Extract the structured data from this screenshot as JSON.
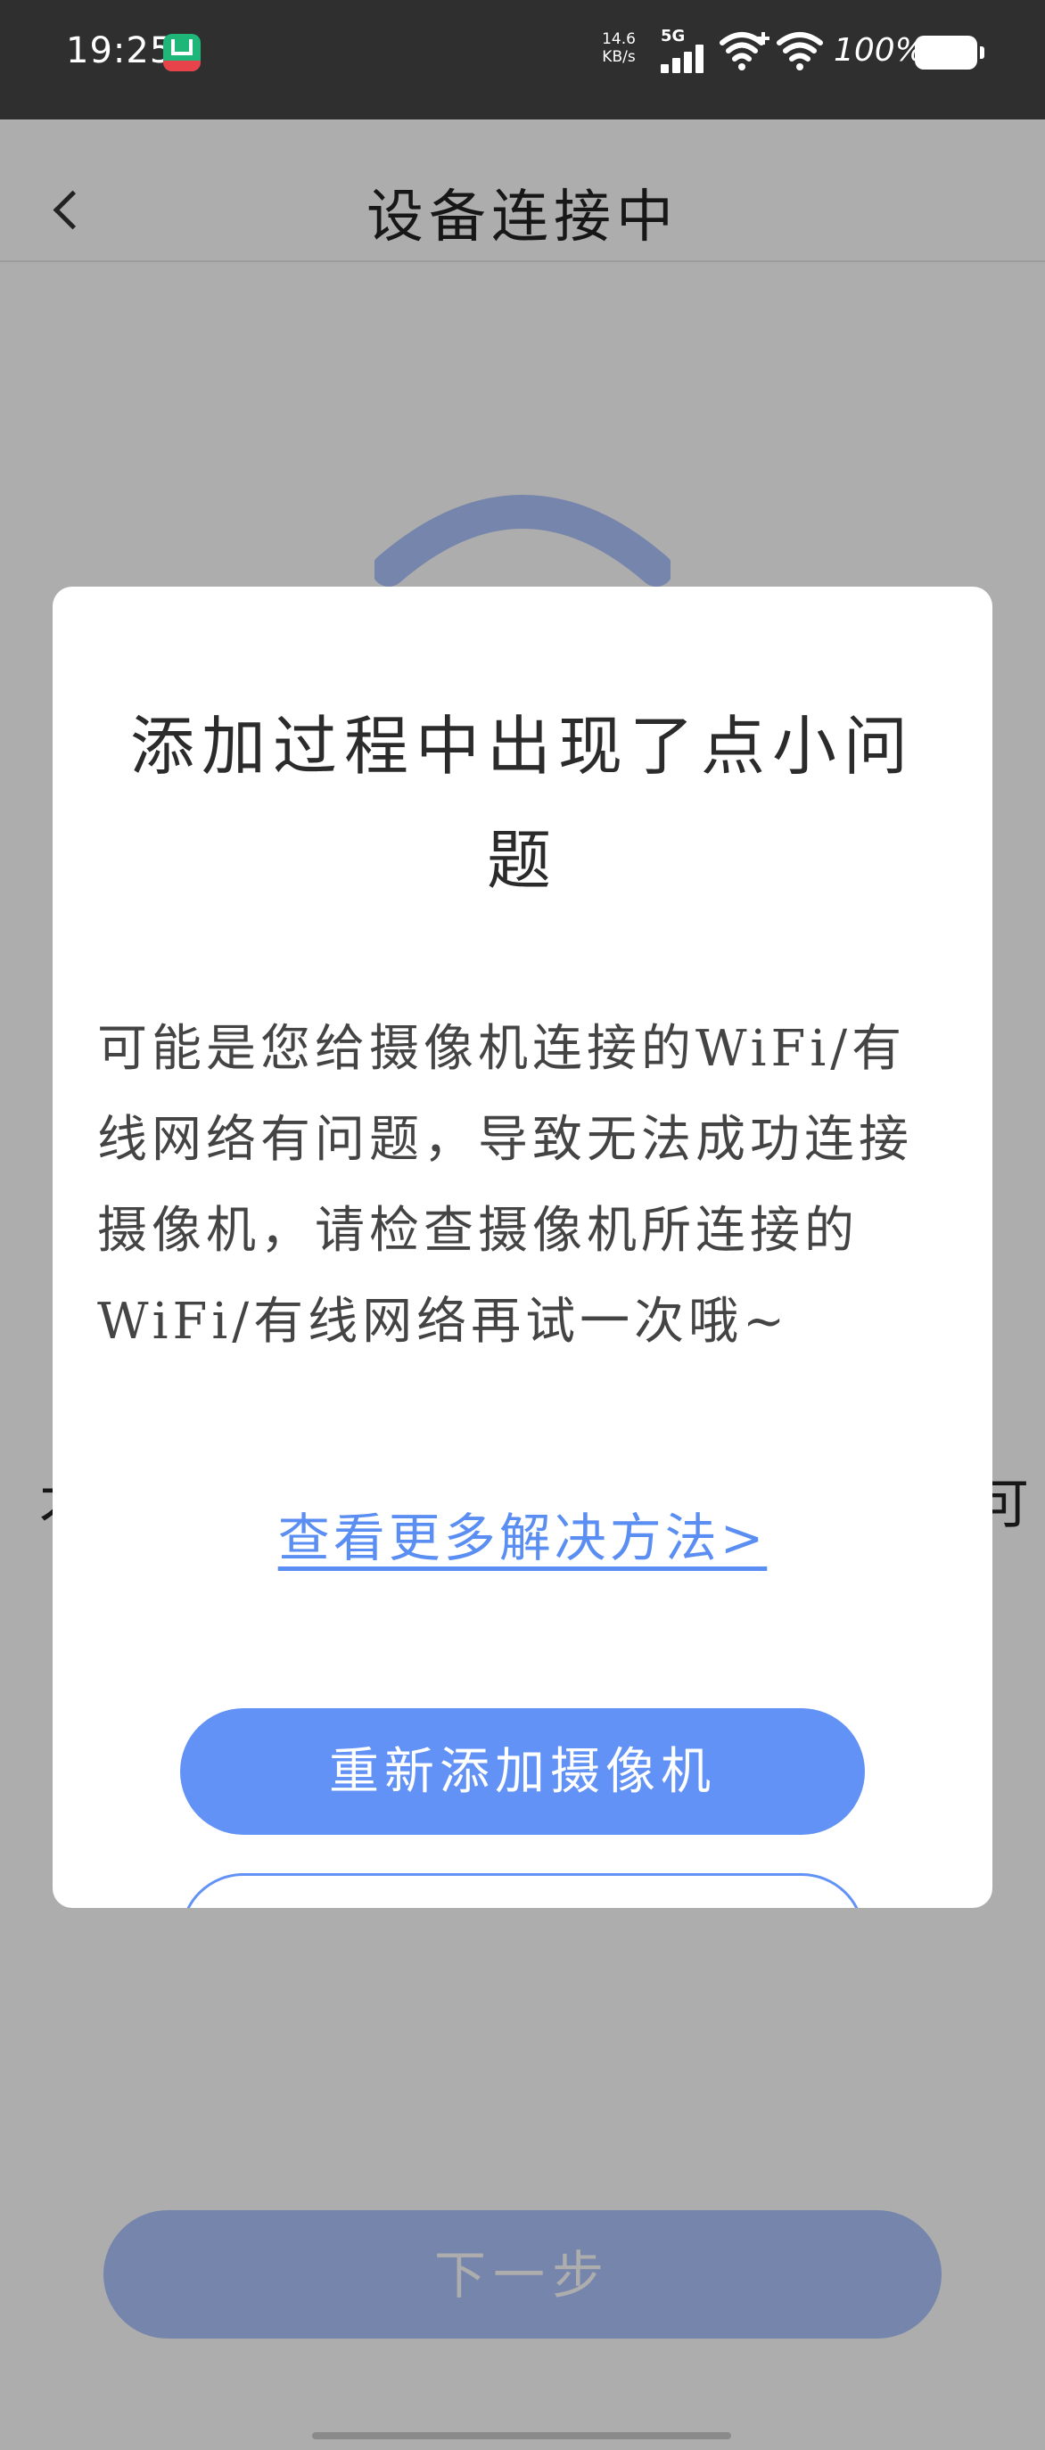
{
  "status_bar": {
    "time": "19:25",
    "net_speed_value": "14.6",
    "net_speed_unit": "KB/s",
    "signal_label": "5G",
    "battery": "100%",
    "icons": [
      "app-notification-icon",
      "cellular-signal-icon",
      "wifi-plus-icon",
      "wifi-icon",
      "battery-icon"
    ]
  },
  "nav": {
    "title": "设备连接中",
    "back_icon": "chevron-left-icon"
  },
  "background": {
    "illustration_icon": "wifi-icon",
    "left_fragment": "才",
    "right_fragment": "可",
    "next_button_label": "下一步",
    "accent_color": "#adc4fc"
  },
  "dialog": {
    "title": "添加过程中出现了点小问题",
    "message": "可能是您给摄像机连接的WiFi/有线网络有问题，导致无法成功连接摄像机，请检查摄像机所连接的WiFi/有线网络再试一次哦~",
    "link_label": "查看更多解决方法>",
    "primary_button_label": "重新添加摄像机",
    "primary_color": "#6392f6",
    "link_color": "#5b8ef2"
  }
}
